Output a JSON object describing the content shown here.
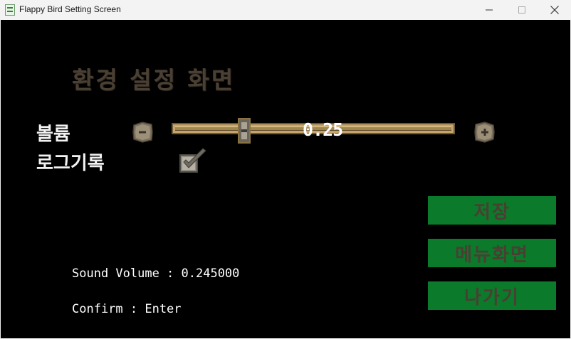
{
  "window": {
    "title": "Flappy Bird Setting Screen"
  },
  "screen": {
    "title": "환경 설정 화면",
    "volume_label": "볼륨",
    "log_label": "로그기록"
  },
  "volume_slider": {
    "value": 0.25,
    "value_text": "0.25",
    "decrease_icon": "minus-icon",
    "increase_icon": "plus-icon"
  },
  "log_checkbox": {
    "checked": true
  },
  "buttons": {
    "save_label": "저장",
    "menu_label": "메뉴화면",
    "exit_label": "나가기"
  },
  "info": {
    "sound_volume": "Sound Volume : 0.245000",
    "confirm": "Confirm : Enter"
  },
  "colors": {
    "background": "#000000",
    "button_green": "#0b7a2a",
    "title_brown": "#4a3f33",
    "slider_gold": "#c6a56c"
  }
}
